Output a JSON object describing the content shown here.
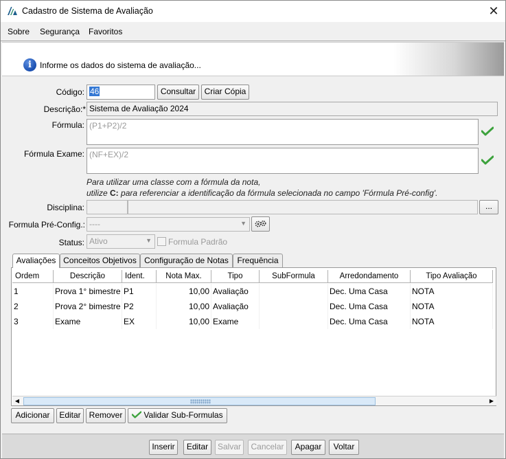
{
  "window": {
    "title": "Cadastro de Sistema de Avaliação",
    "close_symbol": "✕"
  },
  "menu": [
    {
      "label": "Sobre"
    },
    {
      "label": "Segurança"
    },
    {
      "label": "Favoritos"
    }
  ],
  "banner": {
    "text": "Informe os dados do sistema de avaliação..."
  },
  "form": {
    "codigo_label": "Código:",
    "codigo_value": "46",
    "consultar_label": "Consultar",
    "criar_copia_label": "Criar Cópia",
    "descricao_label": "Descrição:*",
    "descricao_value": "Sistema de Avaliação 2024",
    "formula_label": "Fórmula:",
    "formula_value": "(P1+P2)/2",
    "formula_exame_label": "Fórmula Exame:",
    "formula_exame_value": "(NF+EX)/2",
    "hint_line1": "Para utilizar uma classe com a fórmula da nota,",
    "hint_line2_prefix": "utilize ",
    "hint_line2_code": "C:",
    "hint_line2_suffix": " para referenciar a identificação da fórmula selecionada no campo 'Fórmula Pré-config'.",
    "disciplina_label": "Disciplina:",
    "disciplina_code": "",
    "disciplina_name": "",
    "disciplina_button": "...",
    "formula_preconfig_label": "Formula Pré-Config.:",
    "formula_preconfig_value": "----",
    "status_label": "Status:",
    "status_value": "Ativo",
    "formula_padrao_label": "Formula Padrão"
  },
  "tabs": [
    {
      "label": "Avaliações",
      "active": true
    },
    {
      "label": "Conceitos Objetivos",
      "active": false
    },
    {
      "label": "Configuração de Notas",
      "active": false
    },
    {
      "label": "Frequência",
      "active": false
    }
  ],
  "grid": {
    "columns": [
      "Ordem",
      "Descrição",
      "Ident.",
      "Nota Max.",
      "Tipo",
      "SubFormula",
      "Arredondamento",
      "Tipo Avaliação"
    ],
    "rows": [
      [
        "1",
        "Prova 1° bimestre",
        "P1",
        "10,00",
        "Avaliação",
        "",
        "Dec. Uma Casa",
        "NOTA"
      ],
      [
        "2",
        "Prova 2° bimestre",
        "P2",
        "10,00",
        "Avaliação",
        "",
        "Dec. Uma Casa",
        "NOTA"
      ],
      [
        "3",
        "Exame",
        "EX",
        "10,00",
        "Exame",
        "",
        "Dec. Uma Casa",
        "NOTA"
      ]
    ]
  },
  "grid_buttons": {
    "adicionar": "Adicionar",
    "editar": "Editar",
    "remover": "Remover",
    "validar": "Validar Sub-Formulas"
  },
  "footer_buttons": {
    "inserir": "Inserir",
    "editar": "Editar",
    "salvar": "Salvar",
    "cancelar": "Cancelar",
    "apagar": "Apagar",
    "voltar": "Voltar"
  },
  "colors": {
    "valid_check": "#3ca23c",
    "scroll_thumb": "#d9e9f8",
    "info_icon": "#1a4fb0"
  }
}
